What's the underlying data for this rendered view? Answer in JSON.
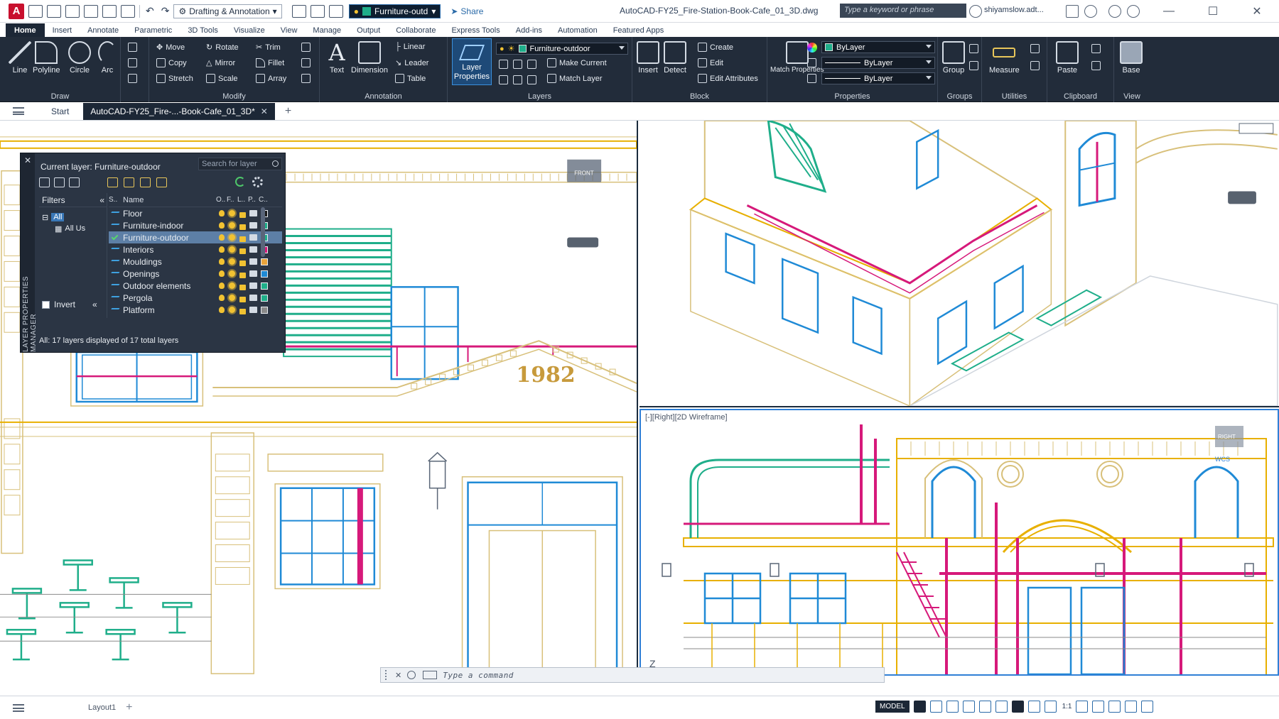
{
  "app": {
    "logo_letter": "A",
    "file_title": "AutoCAD-FY25_Fire-Station-Book-Cafe_01_3D.dwg",
    "workspace": "Drafting & Annotation",
    "quick_layer": "Furniture-outd",
    "share_label": "Share",
    "search_placeholder": "Type a keyword or phrase",
    "user": "shiyamslow.adt..."
  },
  "ribbon": {
    "tabs": [
      "Home",
      "Insert",
      "Annotate",
      "Parametric",
      "3D Tools",
      "Visualize",
      "View",
      "Manage",
      "Output",
      "Collaborate",
      "Express Tools",
      "Add-ins",
      "Automation",
      "Featured Apps"
    ],
    "active_tab": "Home",
    "draw": {
      "title": "Draw",
      "line": "Line",
      "polyline": "Polyline",
      "circle": "Circle",
      "arc": "Arc"
    },
    "modify": {
      "title": "Modify",
      "move": "Move",
      "rotate": "Rotate",
      "trim": "Trim",
      "copy": "Copy",
      "mirror": "Mirror",
      "fillet": "Fillet",
      "stretch": "Stretch",
      "scale": "Scale",
      "array": "Array"
    },
    "annotation": {
      "title": "Annotation",
      "text": "Text",
      "dimension": "Dimension",
      "linear": "Linear",
      "leader": "Leader",
      "table": "Table"
    },
    "layers": {
      "title": "Layers",
      "layer_properties": "Layer Properties",
      "current_layer": "Furniture-outdoor",
      "make_current": "Make Current",
      "match_layer": "Match Layer"
    },
    "block": {
      "title": "Block",
      "insert": "Insert",
      "detect": "Detect",
      "create": "Create",
      "edit": "Edit",
      "edit_attributes": "Edit Attributes"
    },
    "properties": {
      "title": "Properties",
      "match_properties": "Match Properties",
      "color": "ByLayer",
      "linetype": "ByLayer",
      "lineweight": "ByLayer"
    },
    "groups": {
      "title": "Groups",
      "group": "Group"
    },
    "utilities": {
      "title": "Utilities",
      "measure": "Measure"
    },
    "clipboard": {
      "title": "Clipboard",
      "paste": "Paste"
    },
    "view": {
      "title": "View",
      "base": "Base"
    }
  },
  "doc_tabs": {
    "start": "Start",
    "active": "AutoCAD-FY25_Fire-...-Book-Cafe_01_3D*"
  },
  "viewports": {
    "left": {
      "year_text": "1982",
      "viewcube_face": "FRONT"
    },
    "bottom_right": {
      "label": "[-][Right][2D Wireframe]",
      "viewcube_face": "RIGHT",
      "wcs": "WCS",
      "axis_label": "Z"
    }
  },
  "layer_palette": {
    "side_title": "LAYER PROPERTIES MANAGER",
    "current_layer_label": "Current layer: Furniture-outdoor",
    "search_placeholder": "Search for layer",
    "filters_title": "Filters",
    "tree_all": "All",
    "tree_all_used": "All Us",
    "invert_label": "Invert",
    "columns": [
      "S..",
      "Name",
      "O..",
      "F..",
      "L..",
      "P..",
      "C.."
    ],
    "layers": [
      {
        "name": "Floor",
        "color": "#1b1b1b",
        "selected": false
      },
      {
        "name": "Furniture-indoor",
        "color": "#1fae8a",
        "selected": false
      },
      {
        "name": "Furniture-outdoor",
        "color": "#1fae8a",
        "selected": true
      },
      {
        "name": "Interiors",
        "color": "#d6197a",
        "selected": false
      },
      {
        "name": "Mouldings",
        "color": "#e8a33c",
        "selected": false
      },
      {
        "name": "Openings",
        "color": "#1f8ad6",
        "selected": false
      },
      {
        "name": "Outdoor elements",
        "color": "#1fae8a",
        "selected": false
      },
      {
        "name": "Pergola",
        "color": "#1fae8a",
        "selected": false
      },
      {
        "name": "Platform",
        "color": "#8a8a8a",
        "selected": false
      }
    ],
    "footer": "All: 17 layers displayed of 17 total layers"
  },
  "command_line": {
    "placeholder": "Type a command"
  },
  "status_bar": {
    "layout_tab": "Layout1",
    "model_label": "MODEL",
    "scale": "1:1"
  },
  "colors": {
    "ribbon_bg": "#222c3a",
    "accent": "#2f7fd6",
    "mouldings": "#d8c07a",
    "openings": "#1f8ad6",
    "interiors": "#d6197a",
    "furniture": "#1fae8a",
    "platform": "#e8b000"
  }
}
